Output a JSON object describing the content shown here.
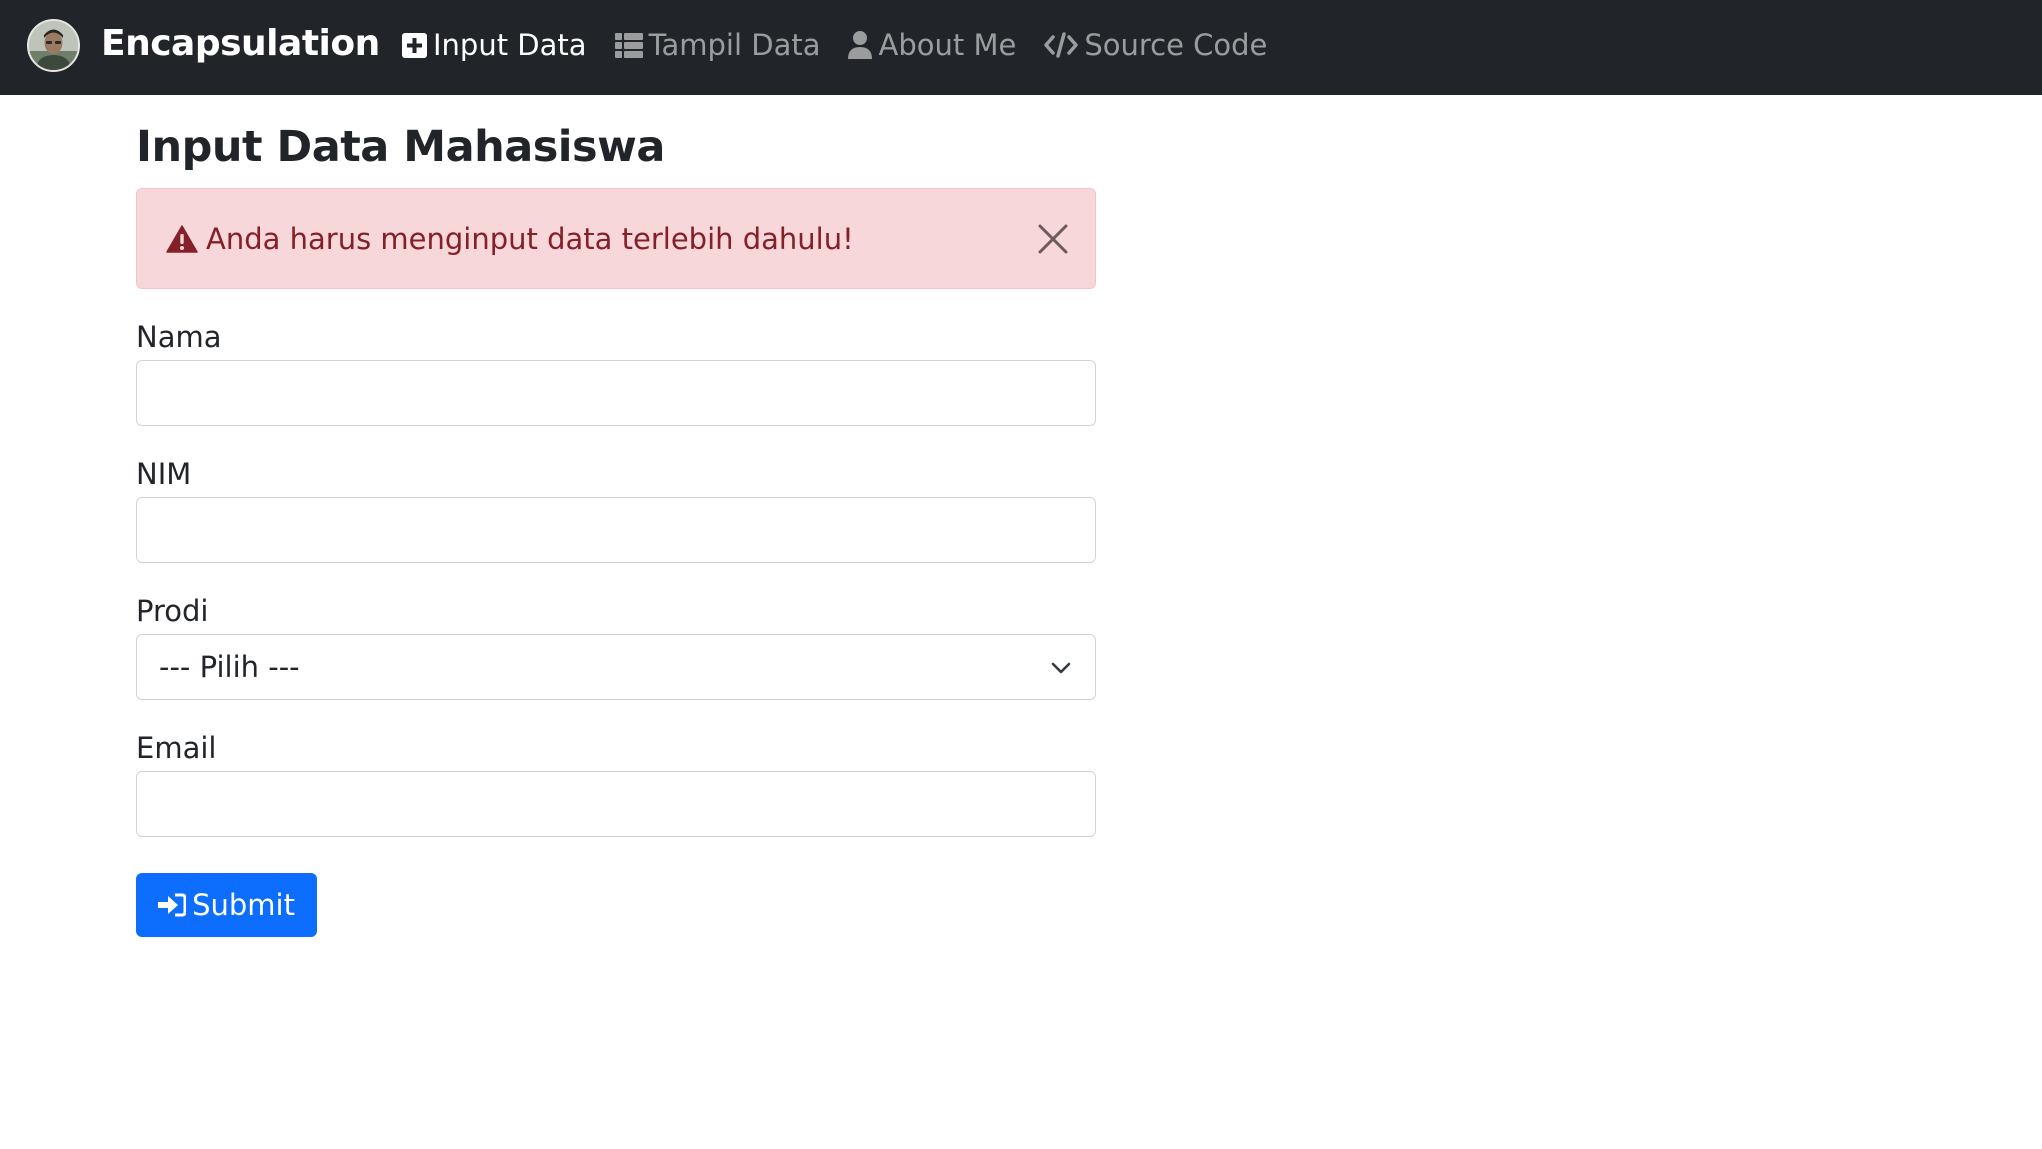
{
  "navbar": {
    "brand": "Encapsulation",
    "links": [
      {
        "label": "Input Data",
        "icon": "plus-square-icon",
        "active": true
      },
      {
        "label": "Tampil Data",
        "icon": "list-icon",
        "active": false
      },
      {
        "label": "About Me",
        "icon": "user-icon",
        "active": false
      },
      {
        "label": "Source Code",
        "icon": "code-icon",
        "active": false
      }
    ]
  },
  "page": {
    "title": "Input Data Mahasiswa"
  },
  "alert": {
    "message": "Anda harus menginput data terlebih dahulu!",
    "icon": "warning-triangle-icon",
    "color": "#842029",
    "background": "#f8d7da"
  },
  "form": {
    "nama_label": "Nama",
    "nama_value": "",
    "nim_label": "NIM",
    "nim_value": "",
    "prodi_label": "Prodi",
    "prodi_selected": "--- Pilih ---",
    "email_label": "Email",
    "email_value": "",
    "submit_label": "Submit"
  },
  "colors": {
    "navbar_bg": "#212529",
    "primary": "#0d6efd"
  }
}
